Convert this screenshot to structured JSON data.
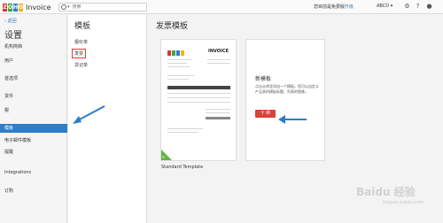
{
  "app": {
    "logo_letters": [
      "Z",
      "O",
      "H",
      "O"
    ],
    "name": "Invoice"
  },
  "search": {
    "placeholder": "搜索"
  },
  "topbar": {
    "trial_text": "您目前是免费版",
    "upgrade": "升级",
    "org": "ABCD"
  },
  "sidebar": {
    "back": "返回",
    "title": "设置",
    "items": [
      {
        "label": "机构简档",
        "active": false
      },
      {
        "label": "用户",
        "active": false
      },
      {
        "label": "首选项",
        "active": false
      },
      {
        "label": "货币",
        "active": false
      },
      {
        "label": "税",
        "active": false
      },
      {
        "label": "模板",
        "active": true
      },
      {
        "label": "电子邮件模板",
        "active": false
      },
      {
        "label": "提醒",
        "active": false
      },
      {
        "label": "Integrations",
        "active": false
      },
      {
        "label": "订购",
        "active": false
      }
    ]
  },
  "templates_menu": {
    "title": "模板",
    "items": [
      "报价单",
      "发票",
      "贷记单"
    ],
    "selected": "发票"
  },
  "main": {
    "title": "发票模板",
    "template_caption": "Standard Template",
    "preview_title": "INVOICE",
    "new_card": {
      "title": "新模板",
      "description": "点击从库里添加一个模板。您可以自定义产品表的模板标题、列表的图像。",
      "button": "十 新"
    }
  },
  "watermark": {
    "brand": "Baidu 经验",
    "sub": "jingyan.baidu.com"
  },
  "colors": {
    "accent": "#2d7dc9",
    "new_button": "#d8423a",
    "highlight_box": "#e53935"
  }
}
